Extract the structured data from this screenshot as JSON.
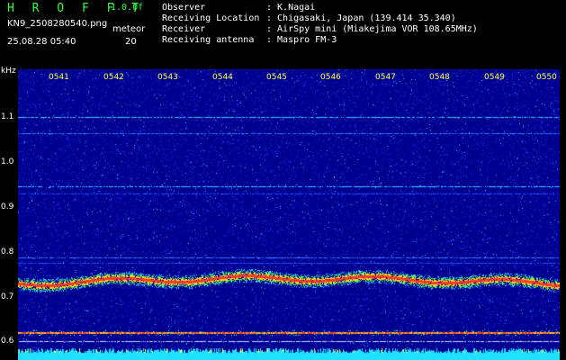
{
  "header": {
    "brand": "H R O F F T",
    "version": "1.0.0f",
    "filename": "KN9_2508280540.png",
    "meteor_label": "meteor",
    "datetime": "25.08.28 05:40",
    "meteor_value": "20",
    "info": [
      {
        "label": "Observer",
        "value": ": K.Nagai"
      },
      {
        "label": "Receiving Location",
        "value": ": Chigasaki, Japan (139.414 35.340)"
      },
      {
        "label": "Receiver",
        "value": ": AirSpy mini (Miakejima VOR 108.65MHz)"
      },
      {
        "label": "Receiving antenna",
        "value": ": Maspro FM-3"
      }
    ]
  },
  "spectrogram": {
    "freq_unit": "kHz",
    "freq_labels": [
      "1.1",
      "1.0",
      "0.9",
      "0.8",
      "0.7",
      "0.6"
    ],
    "time_labels": [
      "0541",
      "0542",
      "0543",
      "0544",
      "0545",
      "0546",
      "0547",
      "0548",
      "0549",
      "0550"
    ],
    "colors": {
      "background": "#00008f",
      "noise_low": "#1e3cff",
      "noise_high": "#2fd0ff",
      "carrier": "#ff3c28",
      "baseline": "#1ee0ff"
    }
  }
}
